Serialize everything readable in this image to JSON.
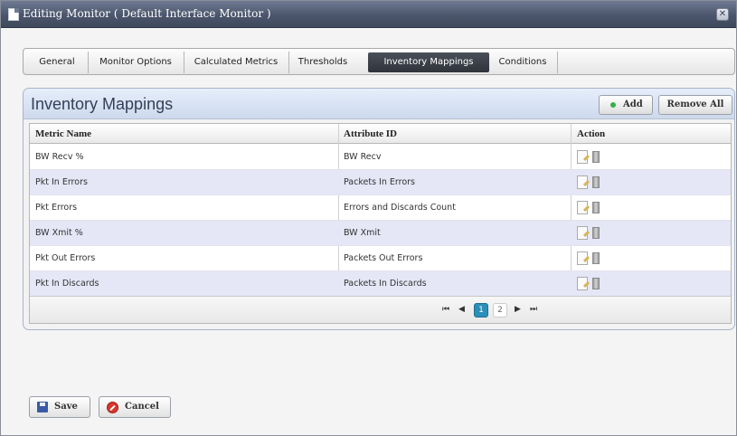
{
  "window": {
    "title": "Editing Monitor ( Default Interface Monitor )",
    "close_glyph": "✕"
  },
  "tabs": [
    {
      "label": "General",
      "active": false
    },
    {
      "label": "Monitor Options",
      "active": false
    },
    {
      "label": "Calculated Metrics",
      "active": false
    },
    {
      "label": "Thresholds",
      "active": false
    },
    {
      "label": "Inventory Mappings",
      "active": true
    },
    {
      "label": "Conditions",
      "active": false
    }
  ],
  "panel": {
    "title": "Inventory Mappings",
    "add_label": "Add",
    "remove_all_label": "Remove All"
  },
  "grid": {
    "columns": [
      "Metric Name",
      "Attribute ID",
      "Action"
    ],
    "rows": [
      {
        "metric": "BW Recv %",
        "attribute": "BW Recv"
      },
      {
        "metric": "Pkt In Errors",
        "attribute": "Packets In Errors"
      },
      {
        "metric": "Pkt Errors",
        "attribute": "Errors and Discards Count"
      },
      {
        "metric": "BW Xmit %",
        "attribute": "BW Xmit"
      },
      {
        "metric": "Pkt Out Errors",
        "attribute": "Packets Out Errors"
      },
      {
        "metric": "Pkt In Discards",
        "attribute": "Packets In Discards"
      }
    ]
  },
  "pager": {
    "first": "⏮",
    "prev": "◀",
    "pages": [
      "1",
      "2"
    ],
    "current_page": "1",
    "next": "▶",
    "last": "⏭"
  },
  "footer": {
    "save_label": "Save",
    "cancel_label": "Cancel"
  },
  "colors": {
    "title_bar": "#4b566c",
    "active_tab": "#2f333b",
    "panel_header": "#cdd9ec",
    "row_alt": "#e5e6f6",
    "current_page": "#2c8fb8",
    "add_dot": "#31b24a",
    "cancel_icon": "#d9362b"
  }
}
